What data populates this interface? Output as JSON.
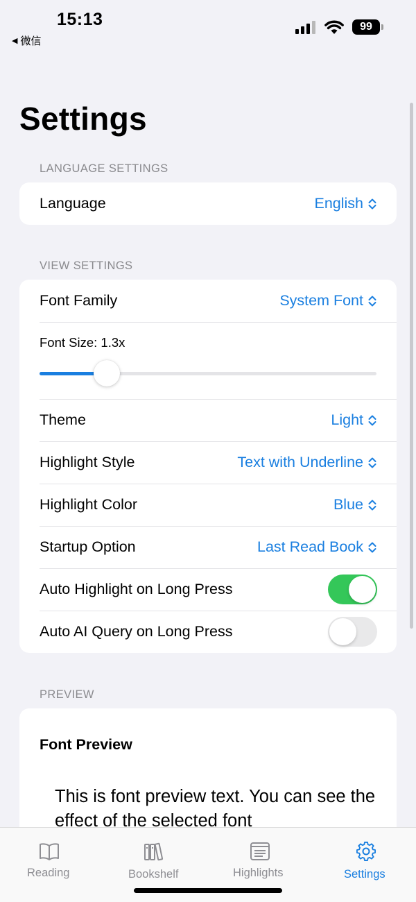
{
  "status_bar": {
    "time": "15:13",
    "back_app": "微信",
    "battery": "99"
  },
  "page": {
    "title": "Settings"
  },
  "sections": {
    "language": {
      "header": "LANGUAGE SETTINGS",
      "language_label": "Language",
      "language_value": "English"
    },
    "view": {
      "header": "VIEW SETTINGS",
      "font_family_label": "Font Family",
      "font_family_value": "System Font",
      "font_size_label": "Font Size: 1.3x",
      "font_size_fraction": 0.2,
      "theme_label": "Theme",
      "theme_value": "Light",
      "highlight_style_label": "Highlight Style",
      "highlight_style_value": "Text with Underline",
      "highlight_color_label": "Highlight Color",
      "highlight_color_value": "Blue",
      "startup_label": "Startup Option",
      "startup_value": "Last Read Book",
      "auto_highlight_label": "Auto Highlight on Long Press",
      "auto_highlight_on": true,
      "auto_ai_label": "Auto AI Query on Long Press",
      "auto_ai_on": false
    },
    "preview": {
      "header": "PREVIEW",
      "title": "Font Preview",
      "text": "This is font preview text. You can see the effect of the selected font"
    }
  },
  "tabbar": {
    "tabs": [
      {
        "label": "Reading",
        "icon": "book-icon",
        "active": false
      },
      {
        "label": "Bookshelf",
        "icon": "bookshelf-icon",
        "active": false
      },
      {
        "label": "Highlights",
        "icon": "highlights-icon",
        "active": false
      },
      {
        "label": "Settings",
        "icon": "gear-icon",
        "active": true
      }
    ]
  },
  "colors": {
    "accent": "#1a7fe0",
    "toggle_on": "#34c759",
    "background": "#f2f2f7",
    "secondary_text": "#8a8a8e"
  }
}
